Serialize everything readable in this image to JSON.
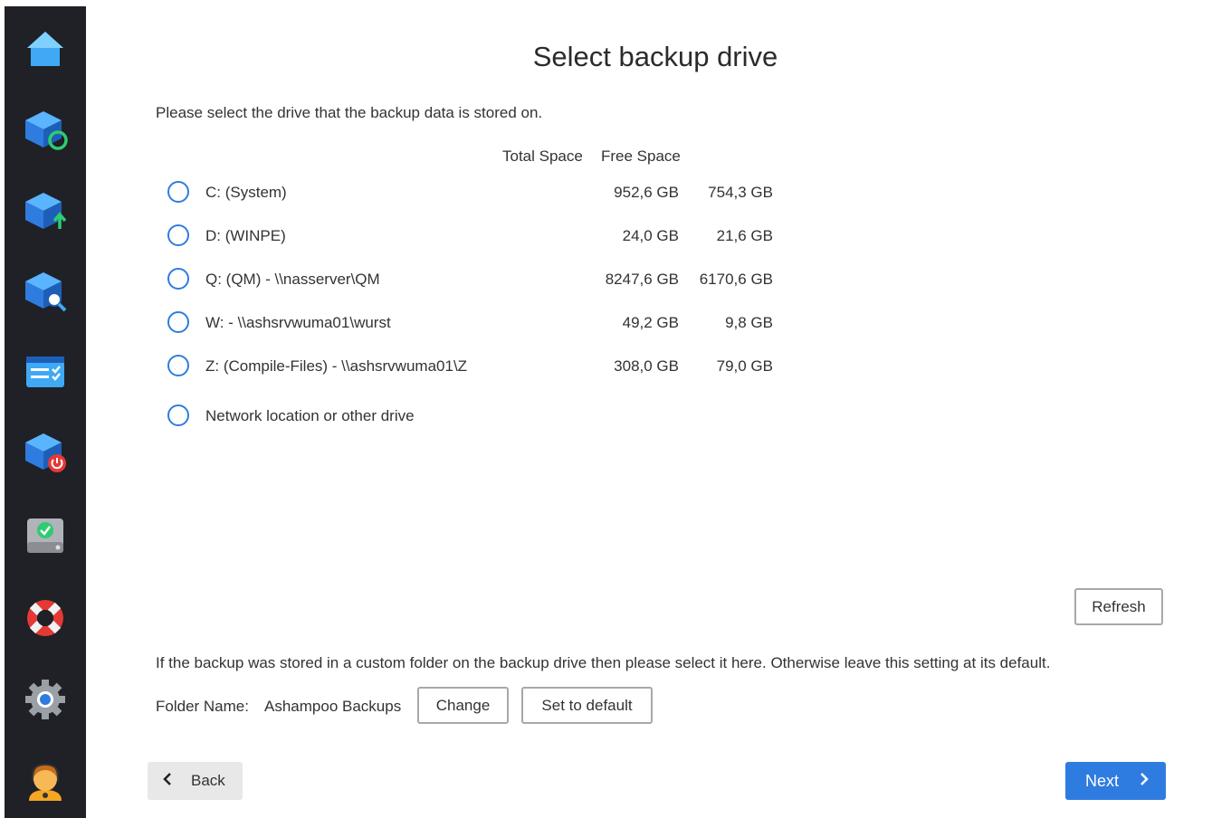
{
  "title": "Select backup drive",
  "intro": "Please select the drive that the backup data is stored on.",
  "columns": {
    "total": "Total Space",
    "free": "Free Space"
  },
  "drives": [
    {
      "name": "C:  (System)",
      "total": "952,6 GB",
      "free": "754,3 GB"
    },
    {
      "name": "D:  (WINPE)",
      "total": "24,0 GB",
      "free": "21,6 GB"
    },
    {
      "name": "Q:  (QM) - \\\\nasserver\\QM",
      "total": "8247,6 GB",
      "free": "6170,6 GB"
    },
    {
      "name": "W: - \\\\ashsrvwuma01\\wurst",
      "total": "49,2 GB",
      "free": "9,8 GB"
    },
    {
      "name": "Z:  (Compile-Files) - \\\\ashsrvwuma01\\Z",
      "total": "308,0 GB",
      "free": "79,0 GB"
    }
  ],
  "network_option": "Network location or other drive",
  "refresh_label": "Refresh",
  "custom_note": "If the backup was stored in a custom folder on the backup drive then please select it here. Otherwise leave this setting at its default.",
  "folder": {
    "label": "Folder Name:",
    "value": "Ashampoo Backups"
  },
  "change_label": "Change",
  "set_default_label": "Set to default",
  "back_label": "Back",
  "next_label": "Next",
  "sidebar": {
    "items": [
      {
        "icon": "home-icon"
      },
      {
        "icon": "restore-backup-icon"
      },
      {
        "icon": "upload-backup-icon"
      },
      {
        "icon": "search-backup-icon"
      },
      {
        "icon": "task-list-icon"
      },
      {
        "icon": "shutdown-backup-icon"
      },
      {
        "icon": "drive-check-icon"
      },
      {
        "icon": "lifebuoy-icon"
      },
      {
        "icon": "settings-gear-icon"
      },
      {
        "icon": "support-agent-icon"
      }
    ]
  },
  "colors": {
    "accent": "#2f7ce0",
    "sidebar_bg": "#1f2126"
  }
}
